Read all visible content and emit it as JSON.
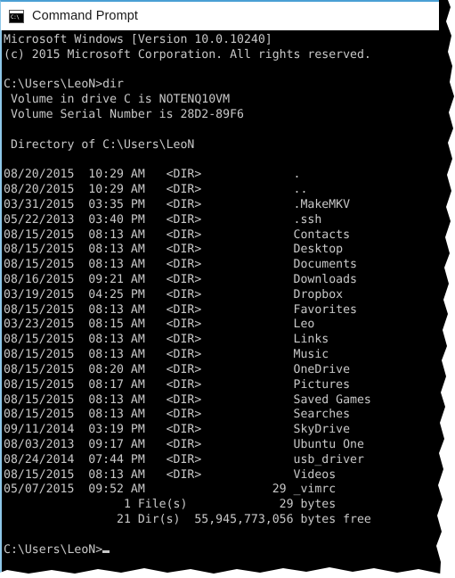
{
  "window": {
    "title": "Command Prompt",
    "icon": "console-icon",
    "icon_glyph": "C:\\",
    "accent_color": "#4a9fd4",
    "titlebar_bg": "#ffffff",
    "console_bg": "#000000",
    "console_fg": "#c8c8c8"
  },
  "console": {
    "banner": [
      "Microsoft Windows [Version 10.0.10240]",
      "(c) 2015 Microsoft Corporation. All rights reserved."
    ],
    "prompt": "C:\\Users\\LeoN>",
    "command": "dir",
    "volume_lines": [
      " Volume in drive C is NOTENQ10VM",
      " Volume Serial Number is 28D2-89F6"
    ],
    "directory_header": " Directory of C:\\Users\\LeoN",
    "columns": [
      "date",
      "time",
      "type_or_size",
      "name"
    ],
    "entries": [
      {
        "date": "08/20/2015",
        "time": "10:29 AM",
        "type": "<DIR>",
        "size": "",
        "name": "."
      },
      {
        "date": "08/20/2015",
        "time": "10:29 AM",
        "type": "<DIR>",
        "size": "",
        "name": ".."
      },
      {
        "date": "03/31/2015",
        "time": "03:35 PM",
        "type": "<DIR>",
        "size": "",
        "name": ".MakeMKV"
      },
      {
        "date": "05/22/2013",
        "time": "03:40 PM",
        "type": "<DIR>",
        "size": "",
        "name": ".ssh"
      },
      {
        "date": "08/15/2015",
        "time": "08:13 AM",
        "type": "<DIR>",
        "size": "",
        "name": "Contacts"
      },
      {
        "date": "08/15/2015",
        "time": "08:13 AM",
        "type": "<DIR>",
        "size": "",
        "name": "Desktop"
      },
      {
        "date": "08/15/2015",
        "time": "08:13 AM",
        "type": "<DIR>",
        "size": "",
        "name": "Documents"
      },
      {
        "date": "08/16/2015",
        "time": "09:21 AM",
        "type": "<DIR>",
        "size": "",
        "name": "Downloads"
      },
      {
        "date": "03/19/2015",
        "time": "04:25 PM",
        "type": "<DIR>",
        "size": "",
        "name": "Dropbox"
      },
      {
        "date": "08/15/2015",
        "time": "08:13 AM",
        "type": "<DIR>",
        "size": "",
        "name": "Favorites"
      },
      {
        "date": "03/23/2015",
        "time": "08:15 AM",
        "type": "<DIR>",
        "size": "",
        "name": "Leo"
      },
      {
        "date": "08/15/2015",
        "time": "08:13 AM",
        "type": "<DIR>",
        "size": "",
        "name": "Links"
      },
      {
        "date": "08/15/2015",
        "time": "08:13 AM",
        "type": "<DIR>",
        "size": "",
        "name": "Music"
      },
      {
        "date": "08/15/2015",
        "time": "08:20 AM",
        "type": "<DIR>",
        "size": "",
        "name": "OneDrive"
      },
      {
        "date": "08/15/2015",
        "time": "08:17 AM",
        "type": "<DIR>",
        "size": "",
        "name": "Pictures"
      },
      {
        "date": "08/15/2015",
        "time": "08:13 AM",
        "type": "<DIR>",
        "size": "",
        "name": "Saved Games"
      },
      {
        "date": "08/15/2015",
        "time": "08:13 AM",
        "type": "<DIR>",
        "size": "",
        "name": "Searches"
      },
      {
        "date": "09/11/2014",
        "time": "03:19 PM",
        "type": "<DIR>",
        "size": "",
        "name": "SkyDrive"
      },
      {
        "date": "08/03/2013",
        "time": "09:17 AM",
        "type": "<DIR>",
        "size": "",
        "name": "Ubuntu One"
      },
      {
        "date": "08/24/2014",
        "time": "07:44 PM",
        "type": "<DIR>",
        "size": "",
        "name": "usb_driver"
      },
      {
        "date": "08/15/2015",
        "time": "08:13 AM",
        "type": "<DIR>",
        "size": "",
        "name": "Videos"
      },
      {
        "date": "05/07/2015",
        "time": "09:52 AM",
        "type": "",
        "size": "29",
        "name": "_vimrc"
      }
    ],
    "summary": {
      "file_count": "1",
      "file_label": "File(s)",
      "file_bytes": "29",
      "file_bytes_label": "bytes",
      "dir_count": "21",
      "dir_label": "Dir(s)",
      "free_bytes": "55,945,773,056",
      "free_label": "bytes free"
    },
    "final_prompt": "C:\\Users\\LeoN>",
    "cursor": "block"
  }
}
